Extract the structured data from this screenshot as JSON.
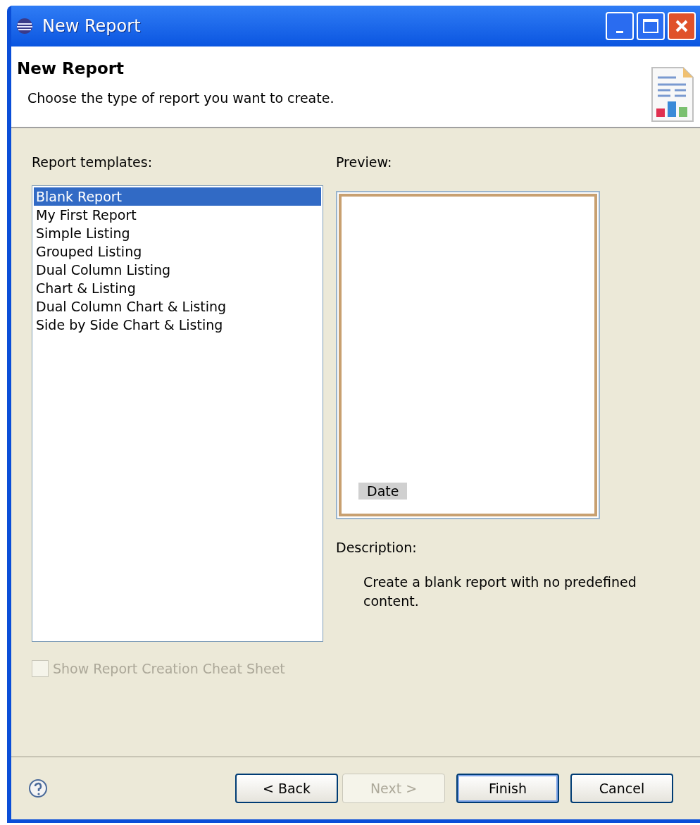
{
  "window": {
    "title": "New Report"
  },
  "header": {
    "title": "New Report",
    "subtitle": "Choose the type of report you want to create."
  },
  "templates": {
    "label": "Report templates:",
    "items": [
      {
        "label": "Blank Report",
        "selected": true
      },
      {
        "label": "My First Report",
        "selected": false
      },
      {
        "label": "Simple Listing",
        "selected": false
      },
      {
        "label": "Grouped Listing",
        "selected": false
      },
      {
        "label": "Dual Column Listing",
        "selected": false
      },
      {
        "label": "Chart & Listing",
        "selected": false
      },
      {
        "label": "Dual Column Chart & Listing",
        "selected": false
      },
      {
        "label": "Side by Side Chart & Listing",
        "selected": false
      }
    ]
  },
  "preview": {
    "label": "Preview:",
    "field": "Date"
  },
  "description": {
    "label": "Description:",
    "text": "Create a blank report with no predefined content."
  },
  "cheat_sheet": {
    "label": "Show Report Creation Cheat Sheet",
    "checked": false,
    "disabled": true
  },
  "buttons": [
    {
      "label": "< Back",
      "disabled": false,
      "default": false
    },
    {
      "label": "Next >",
      "disabled": true,
      "default": false
    },
    {
      "label": "Finish",
      "disabled": false,
      "default": true
    },
    {
      "label": "Cancel",
      "disabled": false,
      "default": false
    }
  ]
}
